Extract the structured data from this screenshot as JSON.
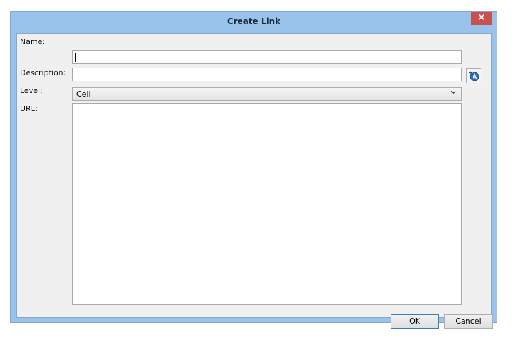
{
  "dialog": {
    "title": "Create Link",
    "close_glyph": "×"
  },
  "form": {
    "name_label": "Name:",
    "name_value": "",
    "description_label": "Description:",
    "description_value": "",
    "level_label": "Level:",
    "level_value": "Cell",
    "url_label": "URL:",
    "url_value": ""
  },
  "icons": {
    "description_button": "add-variable-icon",
    "level_dropdown": "chevron-down-icon",
    "close": "close-icon"
  },
  "buttons": {
    "ok_label": "OK",
    "cancel_label": "Cancel"
  },
  "colors": {
    "titlebar": "#99c3ea",
    "close_button": "#c75050",
    "client_background": "#f0f0f0",
    "ok_border": "#3c7fb1"
  }
}
